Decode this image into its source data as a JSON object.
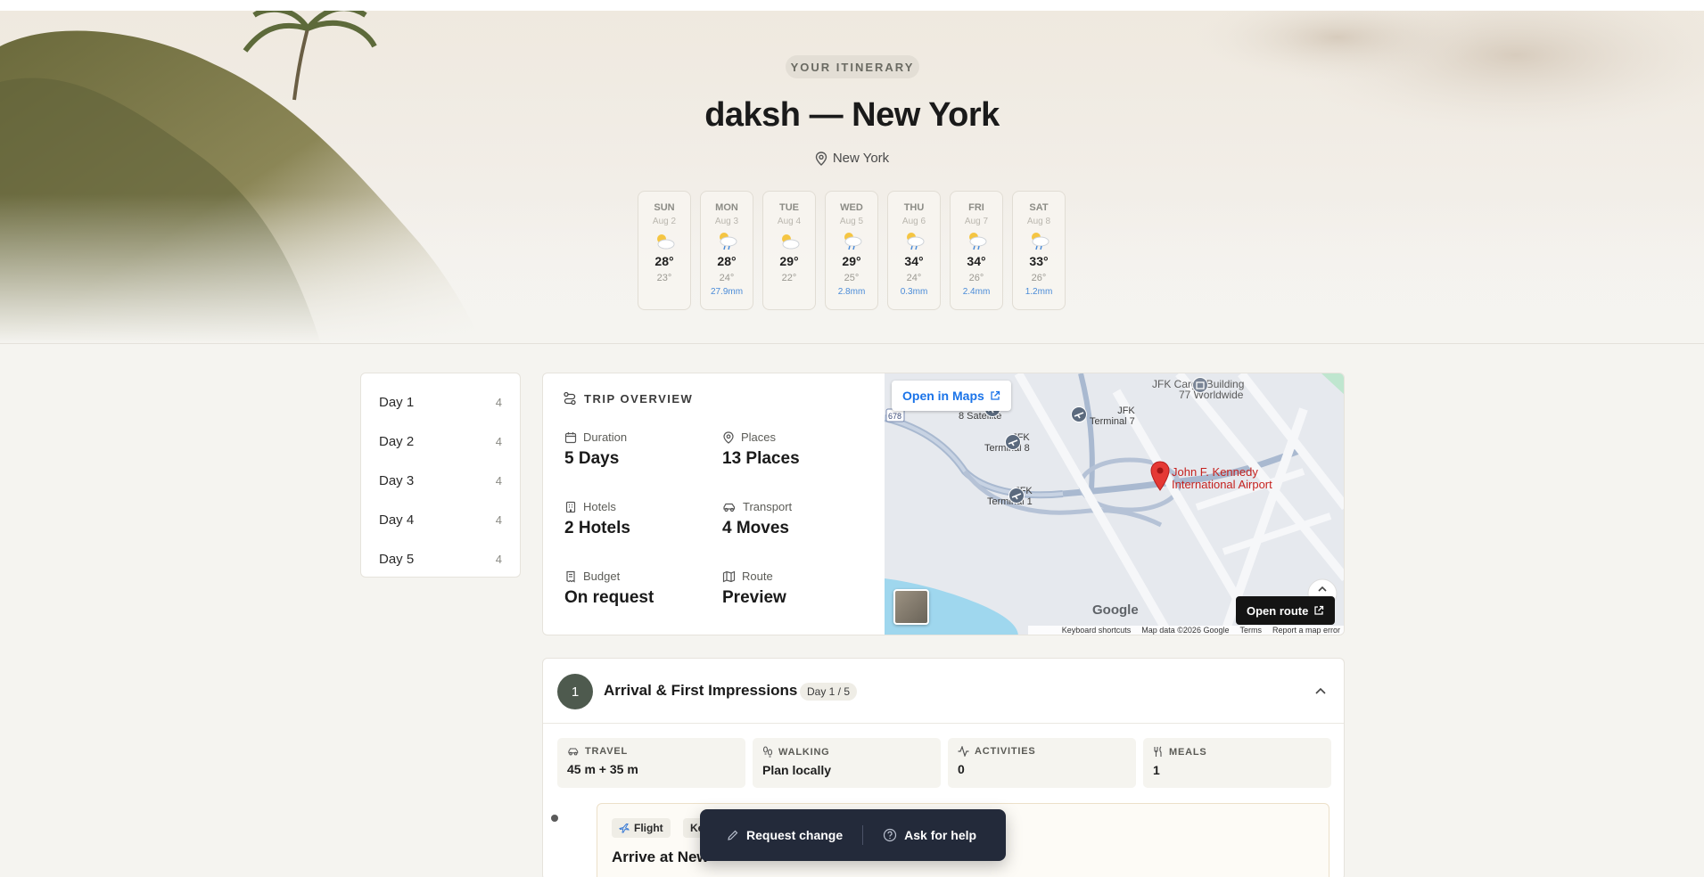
{
  "hero": {
    "eyebrow": "YOUR ITINERARY",
    "title": "daksh — New York",
    "location": "New York"
  },
  "weather": [
    {
      "day": "SUN",
      "date": "Aug 2",
      "icon": "cloud-sun-icon",
      "high": "28°",
      "low": "23°",
      "precip": ""
    },
    {
      "day": "MON",
      "date": "Aug 3",
      "icon": "rain-sun-icon",
      "high": "28°",
      "low": "24°",
      "precip": "27.9mm"
    },
    {
      "day": "TUE",
      "date": "Aug 4",
      "icon": "cloud-sun-icon",
      "high": "29°",
      "low": "22°",
      "precip": ""
    },
    {
      "day": "WED",
      "date": "Aug 5",
      "icon": "rain-sun-icon",
      "high": "29°",
      "low": "25°",
      "precip": "2.8mm"
    },
    {
      "day": "THU",
      "date": "Aug 6",
      "icon": "rain-sun-icon",
      "high": "34°",
      "low": "24°",
      "precip": "0.3mm"
    },
    {
      "day": "FRI",
      "date": "Aug 7",
      "icon": "rain-sun-icon",
      "high": "34°",
      "low": "26°",
      "precip": "2.4mm"
    },
    {
      "day": "SAT",
      "date": "Aug 8",
      "icon": "rain-sun-icon",
      "high": "33°",
      "low": "26°",
      "precip": "1.2mm"
    }
  ],
  "sidebar": {
    "items": [
      {
        "label": "Day 1",
        "count": "4"
      },
      {
        "label": "Day 2",
        "count": "4"
      },
      {
        "label": "Day 3",
        "count": "4"
      },
      {
        "label": "Day 4",
        "count": "4"
      },
      {
        "label": "Day 5",
        "count": "4"
      }
    ]
  },
  "overview": {
    "heading": "TRIP OVERVIEW",
    "stats": {
      "duration": {
        "label": "Duration",
        "value": "5 Days"
      },
      "places": {
        "label": "Places",
        "value": "13 Places"
      },
      "hotels": {
        "label": "Hotels",
        "value": "2 Hotels"
      },
      "transport": {
        "label": "Transport",
        "value": "4 Moves"
      },
      "budget": {
        "label": "Budget",
        "value": "On request"
      },
      "route": {
        "label": "Route",
        "value": "Preview"
      }
    }
  },
  "map": {
    "open_maps": "Open in Maps",
    "open_route": "Open route",
    "highway_shield": "678",
    "labels": {
      "cargo_line1": "JFK Cargo Building",
      "cargo_line2": "77 Worldwide",
      "satellite": "8 Satellite",
      "t7_line1": "JFK",
      "t7_line2": "Terminal 7",
      "t8_line1": "JFK",
      "t8_line2": "Terminal 8",
      "t1_line1": "JFK",
      "t1_line2": "Terminal 1",
      "airport_line1": "John F. Kennedy",
      "airport_line2": "International Airport"
    },
    "logo": "Google",
    "footer": {
      "shortcuts": "Keyboard shortcuts",
      "data": "Map data ©2026 Google",
      "terms": "Terms",
      "report": "Report a map error"
    }
  },
  "day": {
    "number": "1",
    "title": "Arrival & First Impressions",
    "badge": "Day 1 / 5",
    "metrics": {
      "travel": {
        "label": "TRAVEL",
        "value": "45 m + 35 m"
      },
      "walking": {
        "label": "WALKING",
        "value": "Plan locally"
      },
      "activities": {
        "label": "ACTIVITIES",
        "value": "0"
      },
      "meals": {
        "label": "MEALS",
        "value": "1"
      }
    },
    "activity": {
      "chip_type": "Flight",
      "chip_second": "Ke",
      "title": "Arrive at New"
    }
  },
  "floatbar": {
    "request": "Request change",
    "help": "Ask for help"
  },
  "colors": {
    "page_bg": "#f5f4f0",
    "accent_dark": "#4e5a4e",
    "floatbar_bg": "#232a3a",
    "precip_blue": "#4a8bd8",
    "map_link": "#1a73e8",
    "pin_red": "#e53935"
  }
}
